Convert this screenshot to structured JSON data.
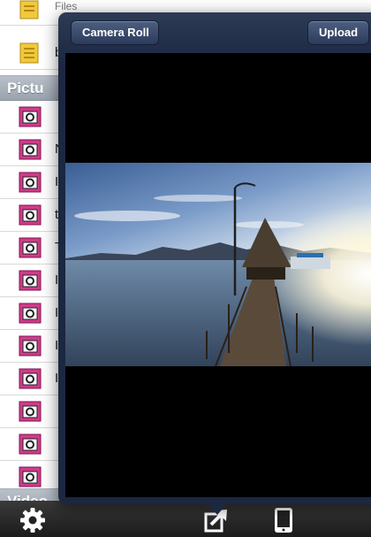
{
  "list": {
    "top_row_text": "Files",
    "folder_row_letter": "b",
    "pictures_section": "Pictu",
    "picture_rows": [
      "",
      "N",
      "I",
      "t",
      "T",
      "I",
      "I",
      "I",
      "I"
    ],
    "video_section": "Video"
  },
  "popover": {
    "back_label": "Camera Roll",
    "upload_label": "Upload",
    "photo_subject": "wooden pier at sunset"
  },
  "toolbar": {
    "settings_icon": "gear-icon",
    "share_icon": "share-icon",
    "device_icon": "device-icon"
  },
  "colors": {
    "popover_bg": "#1c2741",
    "section_header": "#a5adb8",
    "toolbar_bg": "#2a2a2a",
    "picture_icon": "#c2307e",
    "folder_icon": "#e8c23a"
  }
}
